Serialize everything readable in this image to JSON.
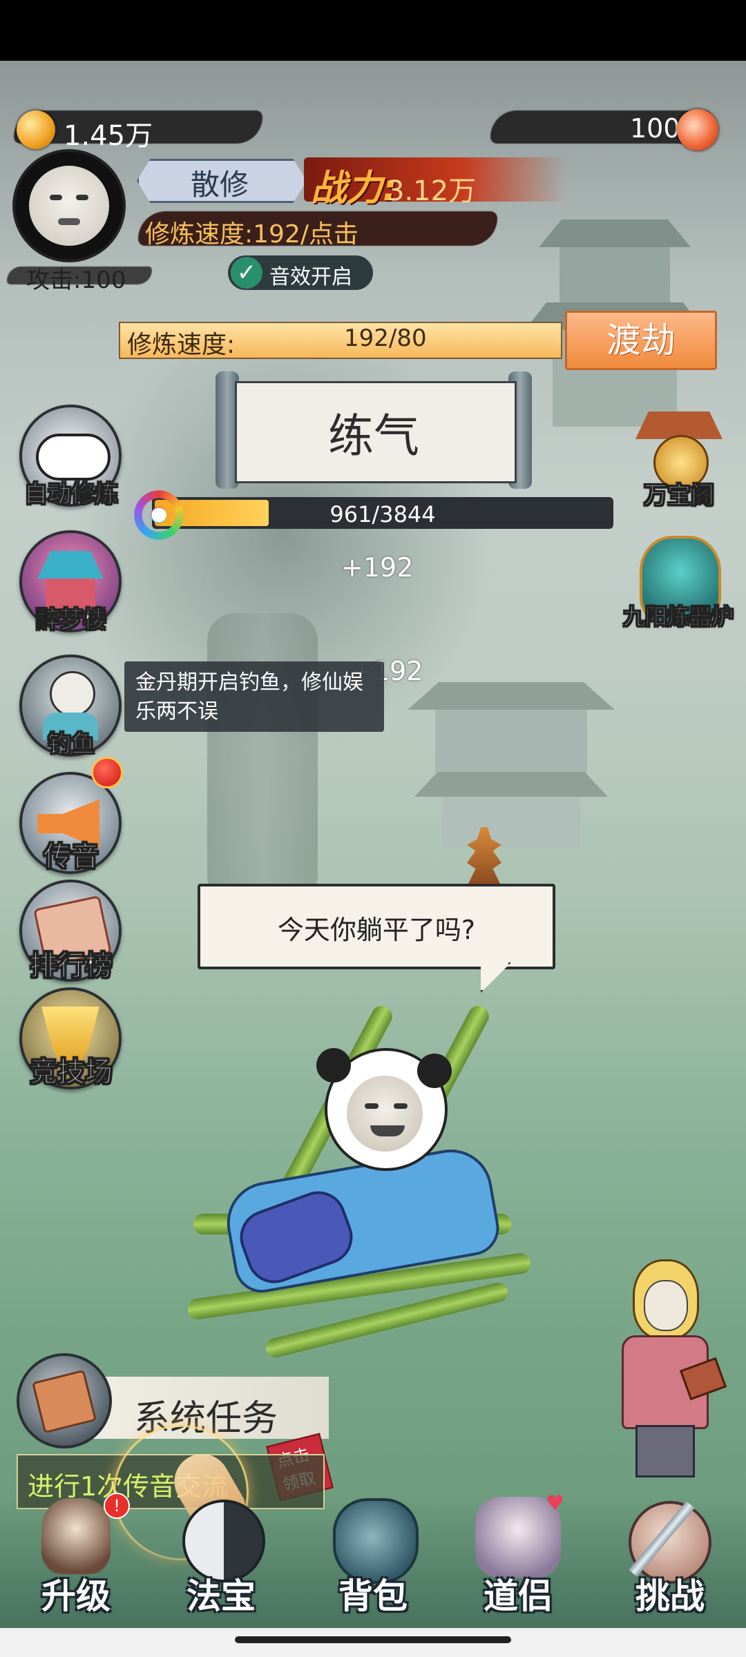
{
  "resources": {
    "coins": "1.45万",
    "gems": "100"
  },
  "player": {
    "rank": "散修",
    "power_label": "战力:",
    "power_value": "3.12万",
    "speed_line": "修炼速度:192/点击",
    "attack": "攻击:100",
    "sound": "音效开启"
  },
  "cultivation": {
    "label": "修炼速度:",
    "value": "192/80",
    "breakthrough_button": "渡劫"
  },
  "realm": {
    "name": "练气",
    "progress_text": "961/3844",
    "progress": 0.25
  },
  "floating": [
    "+192",
    "+192"
  ],
  "left_menu": [
    {
      "label": "自动修炼",
      "icon": "panda-sleeping-icon"
    },
    {
      "label": "醉梦楼",
      "icon": "pavilion-icon"
    },
    {
      "label": "钓鱼",
      "icon": "fishing-icon"
    },
    {
      "label": "传音",
      "icon": "horn-icon"
    },
    {
      "label": "排行榜",
      "icon": "scroll-ranking-icon"
    },
    {
      "label": "竞技场",
      "icon": "trophy-icon"
    }
  ],
  "right_menu": [
    {
      "label": "万宝阁",
      "icon": "treasure-pavilion-icon"
    },
    {
      "label": "九阳炼器炉",
      "icon": "furnace-icon"
    }
  ],
  "tooltip": "金丹期开启钓鱼，修仙娱乐两不误",
  "speech_bubble": "今天你躺平了吗?",
  "task": {
    "title": "系统任务",
    "claim_stamp": "点击领取",
    "description": "进行1次传音交流"
  },
  "bottom_nav": [
    {
      "label": "升级",
      "badge": "!"
    },
    {
      "label": "法宝"
    },
    {
      "label": "背包"
    },
    {
      "label": "道侣"
    },
    {
      "label": "挑战"
    }
  ],
  "colors": {
    "accent_orange": "#f08a3c",
    "progress_fill": "#f5a623",
    "ink": "#2a2a2a"
  }
}
